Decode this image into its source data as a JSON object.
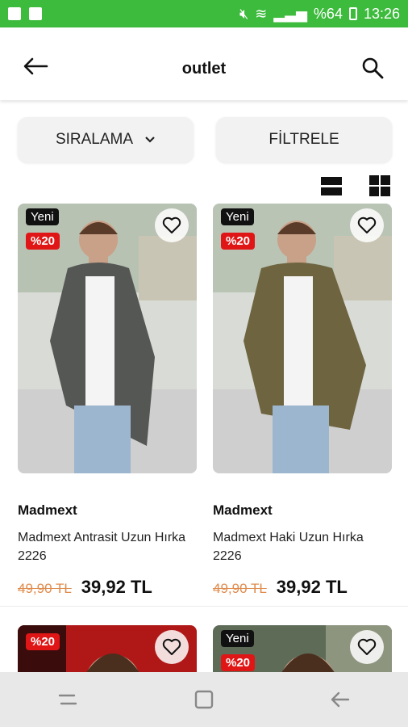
{
  "status_bar": {
    "battery_text": "%64",
    "time": "13:26",
    "colors": {
      "bg": "#3dbb3d"
    }
  },
  "app_bar": {
    "title": "outlet",
    "back_icon": "arrow-left-icon",
    "search_icon": "search-icon"
  },
  "controls": {
    "sort_label": "SIRALAMA",
    "filter_label": "FİLTRELE"
  },
  "view_toggles": [
    "list-view-icon",
    "grid-view-icon"
  ],
  "products": [
    {
      "badge_new": "Yeni",
      "badge_discount": "%20",
      "brand": "Madmext",
      "name": "Madmext Antrasit Uzun Hırka 2226",
      "old_price": "49,90 TL",
      "new_price": "39,92 TL",
      "cardigan_color": "#555755"
    },
    {
      "badge_new": "Yeni",
      "badge_discount": "%20",
      "brand": "Madmext",
      "name": "Madmext Haki Uzun Hırka 2226",
      "old_price": "49,90 TL",
      "new_price": "39,92 TL",
      "cardigan_color": "#6e6440"
    },
    {
      "badge_discount": "%20"
    },
    {
      "badge_new": "Yeni",
      "badge_discount": "%20"
    }
  ],
  "nav": [
    "recent-apps-icon",
    "home-icon",
    "back-icon"
  ]
}
